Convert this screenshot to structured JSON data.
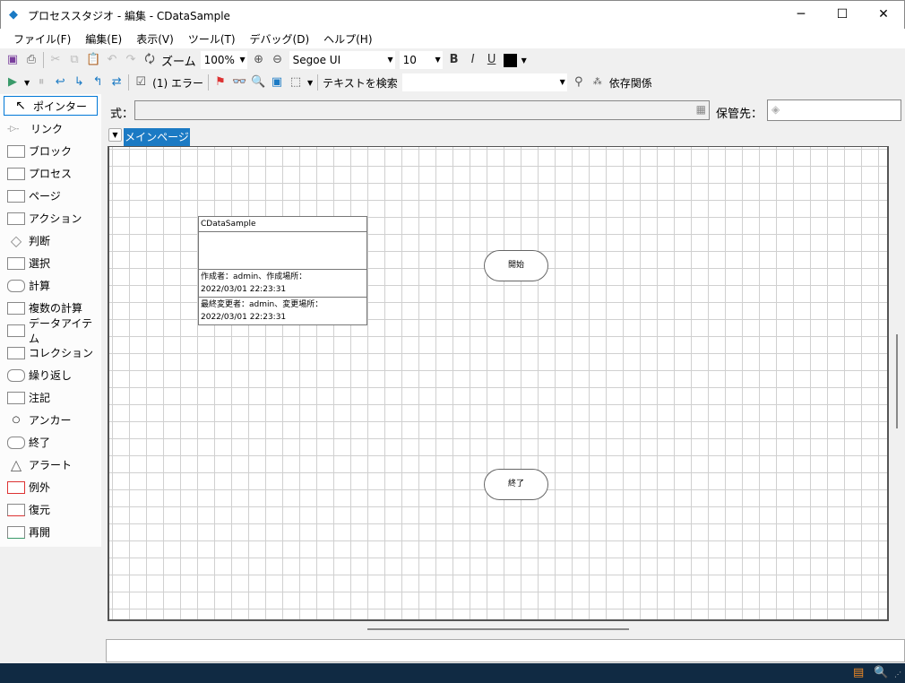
{
  "window": {
    "title": "プロセススタジオ - 編集 - CDataSample",
    "minimize": "─",
    "maximize": "☐",
    "close": "✕"
  },
  "menu": [
    "ファイル(F)",
    "編集(E)",
    "表示(V)",
    "ツール(T)",
    "デバッグ(D)",
    "ヘルプ(H)"
  ],
  "toolbar1": {
    "zoom_label": "ズーム",
    "zoom_value": "100%",
    "font": "Segoe UI",
    "font_size": "10",
    "bold": "B",
    "italic": "I",
    "underline": "U",
    "color": "#000000"
  },
  "toolbar2": {
    "errors": "(1) エラー",
    "search_label": "テキストを検索",
    "search_value": "",
    "dependencies": "依存関係"
  },
  "expression": {
    "label": "式：",
    "value": ""
  },
  "store": {
    "label": "保管先：",
    "value": ""
  },
  "toolbox": [
    {
      "label": "ポインター",
      "icon": "pointer-icon"
    },
    {
      "label": "リンク",
      "icon": "link-icon"
    },
    {
      "label": "ブロック",
      "icon": "block-icon"
    },
    {
      "label": "プロセス",
      "icon": "process-icon"
    },
    {
      "label": "ページ",
      "icon": "page-icon"
    },
    {
      "label": "アクション",
      "icon": "action-icon"
    },
    {
      "label": "判断",
      "icon": "decision-icon"
    },
    {
      "label": "選択",
      "icon": "choice-icon"
    },
    {
      "label": "計算",
      "icon": "calculation-icon"
    },
    {
      "label": "複数の計算",
      "icon": "multi-calculation-icon"
    },
    {
      "label": "データアイテム",
      "icon": "data-item-icon"
    },
    {
      "label": "コレクション",
      "icon": "collection-icon"
    },
    {
      "label": "繰り返し",
      "icon": "loop-icon"
    },
    {
      "label": "注記",
      "icon": "note-icon"
    },
    {
      "label": "アンカー",
      "icon": "anchor-icon"
    },
    {
      "label": "終了",
      "icon": "end-icon"
    },
    {
      "label": "アラート",
      "icon": "alert-icon"
    },
    {
      "label": "例外",
      "icon": "exception-icon"
    },
    {
      "label": "復元",
      "icon": "recover-icon"
    },
    {
      "label": "再開",
      "icon": "resume-icon"
    }
  ],
  "tabs": {
    "active": "メインページ"
  },
  "canvas": {
    "info": {
      "name": "CDataSample",
      "created": "作成者：admin、作成場所：",
      "created_at": "2022/03/01 22:23:31",
      "modified": "最終変更者：admin、変更場所：",
      "modified_at": "2022/03/01 22:23:31"
    },
    "start": "開始",
    "end": "終了"
  }
}
